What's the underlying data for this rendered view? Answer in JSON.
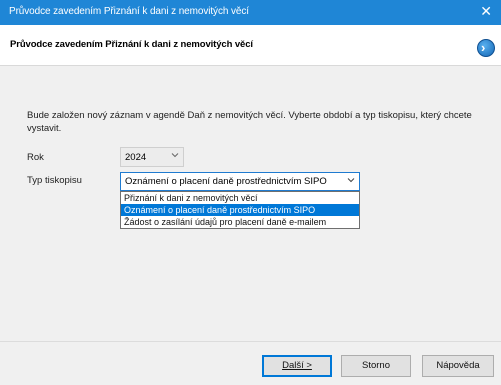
{
  "window": {
    "title": "Průvodce zavedením Přiznání k dani z nemovitých věcí",
    "close_glyph": "✕"
  },
  "header": {
    "title": "Průvodce zavedením Přiznání k dani z nemovitých věcí",
    "logo_icon": "arrow-circle-icon",
    "accent_color": "#1f86d6"
  },
  "main": {
    "intro": "Bude založen nový záznam v agendě Daň z nemovitých věcí. Vyberte období a typ tiskopisu, který chcete vystavit.",
    "year": {
      "label": "Rok",
      "value": "2024"
    },
    "type": {
      "label": "Typ tiskopisu",
      "value": "Oznámení o placení daně prostřednictvím SIPO",
      "options": [
        "Přiznání k dani z nemovitých věcí",
        "Oznámení o placení daně prostřednictvím SIPO",
        "Žádost o zasílání údajů pro placení daně e-mailem"
      ],
      "selected_index": 1
    }
  },
  "footer": {
    "next_label": "Další >",
    "cancel_label": "Storno",
    "help_label": "Nápověda"
  }
}
